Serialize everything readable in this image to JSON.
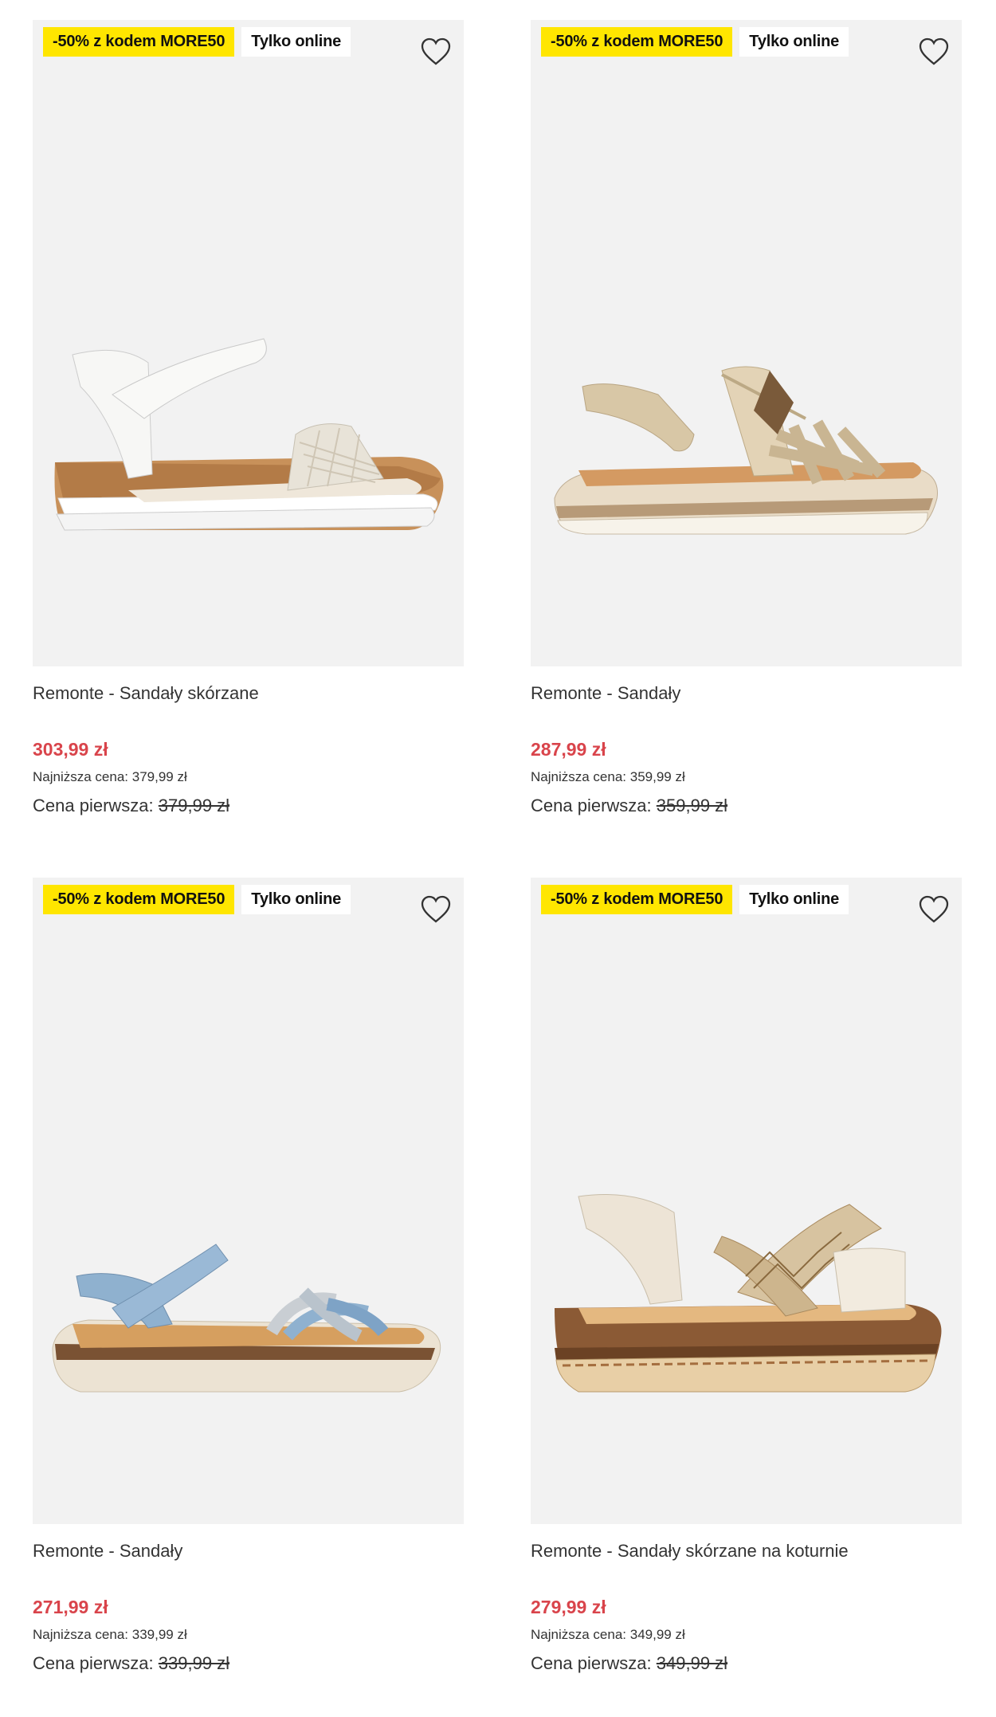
{
  "products": [
    {
      "promo_badge": "-50% z kodem MORE50",
      "online_badge": "Tylko online",
      "title": "Remonte - Sandały skórzane",
      "price": "303,99 zł",
      "lowest_label": "Najniższa cena:",
      "lowest_value": "379,99 zł",
      "first_label": "Cena pierwsza:",
      "first_value": "379,99 zł",
      "image": "white-woven-wedge-sandal"
    },
    {
      "promo_badge": "-50% z kodem MORE50",
      "online_badge": "Tylko online",
      "title": "Remonte - Sandały",
      "price": "287,99 zł",
      "lowest_label": "Najniższa cena:",
      "lowest_value": "359,99 zł",
      "first_label": "Cena pierwsza:",
      "first_value": "359,99 zł",
      "image": "gold-strappy-platform-sandal"
    },
    {
      "promo_badge": "-50% z kodem MORE50",
      "online_badge": "Tylko online",
      "title": "Remonte - Sandały",
      "price": "271,99 zł",
      "lowest_label": "Najniższa cena:",
      "lowest_value": "339,99 zł",
      "first_label": "Cena pierwsza:",
      "first_value": "339,99 zł",
      "image": "blue-cross-strap-sandal"
    },
    {
      "promo_badge": "-50% z kodem MORE50",
      "online_badge": "Tylko online",
      "title": "Remonte - Sandały skórzane na koturnie",
      "price": "279,99 zł",
      "lowest_label": "Najniższa cena:",
      "lowest_value": "349,99 zł",
      "first_label": "Cena pierwsza:",
      "first_value": "349,99 zł",
      "image": "beige-woven-wedge-sandal"
    }
  ],
  "icons": {
    "wishlist": "heart-outline-icon"
  },
  "colors": {
    "promo_badge_bg": "#ffe600",
    "price": "#d9444b",
    "image_bg": "#f2f2f2"
  }
}
